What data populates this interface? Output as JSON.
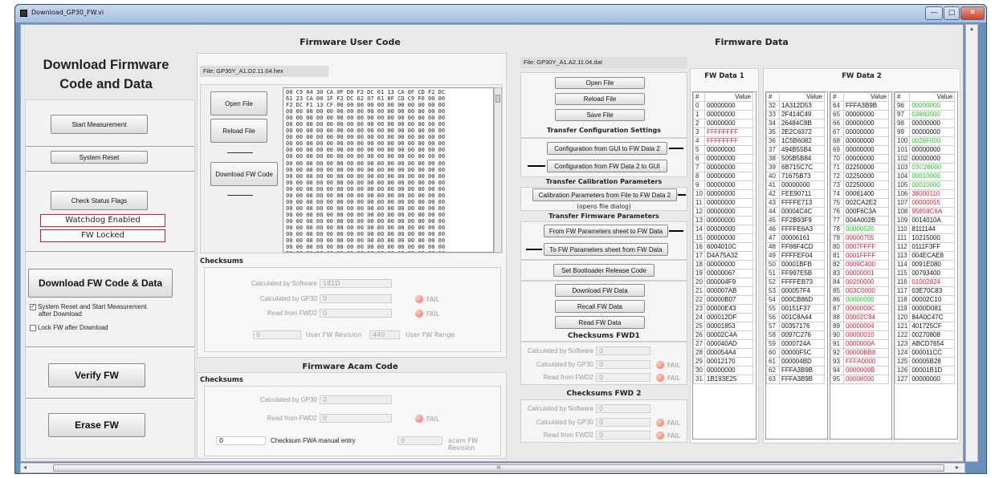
{
  "window": {
    "title": "Download_GP30_FW.vi"
  },
  "colors": {
    "red": "#e0203a",
    "green": "#22cc22",
    "black": "#111111"
  },
  "left": {
    "title_line1": "Download Firmware",
    "title_line2": "Code and Data",
    "start": "Start Measurement",
    "reset": "System Reset",
    "check": "Check Status Flags",
    "watchdog": "Watchdog Enabled",
    "fwlocked": "FW Locked",
    "download": "Download FW Code & Data",
    "opt1a": "System Reset and Start Measurement",
    "opt1b": "after Download",
    "opt2": "Lock FW after Download",
    "verify": "Verify FW",
    "erase": "Erase FW"
  },
  "usercode": {
    "title": "Firmware User Code",
    "file": "File:  GP30Y_A1.D2.11.04.hex",
    "open": "Open File",
    "reload": "Reload File",
    "download": "Download FW Code",
    "hex_lines": [
      "00 C9 04 30 CA 0F D0 F2 DC 61 13 CA 0F CD F2 DC",
      "61 23 CA 00 1F F2 DC 62 07 61 0F CD C9 F0 00 00",
      "F2 DC F1 13 CF 00 00 00 00 00 00 00 00 00 00 00",
      "00 00 00 00 00 00 00 00 00 00 00 00 00 00 00 00",
      "00 00 00 00 00 00 00 00 00 00 00 00 00 00 00 00",
      "00 00 00 00 00 00 00 00 00 00 00 00 00 00 00 00",
      "00 00 00 00 00 00 00 00 00 00 00 00 00 00 00 00",
      "00 00 00 00 00 00 00 00 00 00 00 00 00 00 00 00",
      "00 00 00 00 00 00 00 00 00 00 00 00 00 00 00 00",
      "00 00 00 00 00 00 00 00 00 00 00 00 00 00 00 00",
      "00 00 00 00 00 00 00 00 00 00 00 00 00 00 00 00",
      "00 00 00 00 00 00 00 00 00 00 00 00 00 00 00 00",
      "00 00 00 00 00 00 00 00 00 00 00 00 00 00 00 00",
      "00 00 00 00 00 00 00 00 00 00 00 00 00 00 00 00",
      "00 00 00 00 00 00 00 00 00 00 00 00 00 00 00 00",
      "00 00 00 00 00 00 00 00 00 00 00 00 00 00 00 00",
      "00 00 00 00 00 00 00 00 00 00 00 00 00 00 00 00",
      "00 00 00 00 00 00 00 00 00 00 00 00 00 00 00 00",
      "00 00 00 00 00 00 00 00 00 00 00 00 00 00 00 00",
      "00 00 00 00 00 00 00 00 00 00 00 00 00 00 00 00",
      "00 00 00 00 00 00 00 00 00 00 00 00 00 00 00 00",
      "00 00 00 00 00 00 00 00 00 00 00 00 00 00 00 00",
      "00 00 00 00 00 00 00 00 00 00 00 00 00 00 00 00",
      "00 00 00 00 00 00 00 00 00 00 00 00 00 00 00 00",
      "00 00 00 00 00 00 00 00 00 00 00 00 00 00 00 00",
      "00 00 00 00 00 00 00 00 00 00 00 00 00 00 00 00"
    ],
    "checksums": "Checksums",
    "calc_sw": "Calculated by Software",
    "calc_sw_val": "181D",
    "calc_gp30": "Calculated by GP30",
    "calc_gp30_val": "0",
    "read_fwd2": "Read from FWD2",
    "read_fwd2_val": "0",
    "fail": "FAIL",
    "rev_val": "0",
    "rev_label": "User FW Revision",
    "range_val": "440",
    "range_label": "User FW Range"
  },
  "acam": {
    "title": "Firmware Acam Code",
    "checksums": "Checksums",
    "calc_gp30": "Calculated by GP30",
    "calc_gp30_val": "0",
    "read_fwd2": "Read from FWD2",
    "read_fwd2_val": "0",
    "fail": "FAIL",
    "manual_val": "0",
    "manual_label": "Checksum FWA manual entry",
    "rev_val": "0",
    "rev_label": "acam FW Revision"
  },
  "fwdata": {
    "title": "Firmware Data",
    "file": "File:  GP30Y_A1.A2.11.04.dat",
    "open": "Open File",
    "reload": "Reload File",
    "save": "Save File",
    "tcs": "Transfer Configuration Settings",
    "gui_to_fw": "Configuration from GUI to FW Data 2",
    "fw_to_gui": "Configuration from FW Data 2 to GUI",
    "tcp": "Transfer Calibration Parameters",
    "cal": "Calibration Parameters from File to FW Data 2",
    "cal_note": "(opens file dialog)",
    "tfp": "Transfer Firmware Parameters",
    "from_sheet": "From FW Parameters sheet to FW Data",
    "to_sheet": "To FW Parameters sheet from FW Data",
    "bootloader": "Set Bootloader Release Code",
    "download": "Download FW Data",
    "recall": "Recall FW Data",
    "read": "Read FW Data",
    "cs1": "Checksums FWD1",
    "cs2": "Checksums FWD 2",
    "calc_sw": "Calculated by Software",
    "calc_gp30": "Calculated by GP30",
    "read_fwd2": "Read from FWD2",
    "zero": "0",
    "fail": "FAIL",
    "fwd1_title": "FW Data 1",
    "fwd2_title": "FW Data 2",
    "col_hash": "#",
    "col_value": "Value",
    "fwd1": [
      [
        "0",
        "00000000",
        "k"
      ],
      [
        "1",
        "00000000",
        "k"
      ],
      [
        "2",
        "00000000",
        "k"
      ],
      [
        "3",
        "FFFFFFFF",
        "r"
      ],
      [
        "4",
        "FFFFFFFF",
        "r"
      ],
      [
        "5",
        "00000000",
        "k"
      ],
      [
        "6",
        "00000000",
        "k"
      ],
      [
        "7",
        "00000000",
        "k"
      ],
      [
        "8",
        "00000000",
        "k"
      ],
      [
        "9",
        "00000000",
        "k"
      ],
      [
        "10",
        "00000000",
        "k"
      ],
      [
        "11",
        "00000000",
        "k"
      ],
      [
        "12",
        "00000000",
        "k"
      ],
      [
        "13",
        "00000000",
        "k"
      ],
      [
        "14",
        "00000000",
        "k"
      ],
      [
        "15",
        "00000000",
        "k"
      ],
      [
        "16",
        "6004010C",
        "k"
      ],
      [
        "17",
        "D4A75A32",
        "k"
      ],
      [
        "18",
        "00000000",
        "k"
      ],
      [
        "19",
        "00000067",
        "k"
      ],
      [
        "20",
        "000004F9",
        "k"
      ],
      [
        "21",
        "000007AB",
        "k"
      ],
      [
        "22",
        "00000B07",
        "k"
      ],
      [
        "23",
        "00000E43",
        "k"
      ],
      [
        "24",
        "000012DF",
        "k"
      ],
      [
        "25",
        "00001853",
        "k"
      ],
      [
        "26",
        "00002C4A",
        "k"
      ],
      [
        "27",
        "000040AD",
        "k"
      ],
      [
        "28",
        "000054A4",
        "k"
      ],
      [
        "29",
        "00012170",
        "k"
      ],
      [
        "30",
        "00000000",
        "k"
      ],
      [
        "31",
        "1B193E25",
        "k"
      ]
    ],
    "fwd2a": [
      [
        "32",
        "1A312D53",
        "k"
      ],
      [
        "33",
        "2F414C49",
        "k"
      ],
      [
        "34",
        "26484C8B",
        "k"
      ],
      [
        "35",
        "2E2C6372",
        "k"
      ],
      [
        "36",
        "1C5B6082",
        "k"
      ],
      [
        "37",
        "494B55B4",
        "k"
      ],
      [
        "38",
        "505B5B84",
        "k"
      ],
      [
        "39",
        "6B715C7C",
        "k"
      ],
      [
        "40",
        "71675B73",
        "k"
      ],
      [
        "41",
        "00000000",
        "k"
      ],
      [
        "42",
        "FEE90711",
        "k"
      ],
      [
        "43",
        "FFFFE713",
        "k"
      ],
      [
        "44",
        "00004C4C",
        "k"
      ],
      [
        "45",
        "FF2B93F9",
        "k"
      ],
      [
        "46",
        "FFFFE6A3",
        "k"
      ],
      [
        "47",
        "00006161",
        "k"
      ],
      [
        "48",
        "FF86F4CD",
        "k"
      ],
      [
        "49",
        "FFFFEF04",
        "k"
      ],
      [
        "50",
        "00001BFB",
        "k"
      ],
      [
        "51",
        "FF997E5B",
        "k"
      ],
      [
        "52",
        "FFFFEB73",
        "k"
      ],
      [
        "53",
        "000057F4",
        "k"
      ],
      [
        "54",
        "000CB86D",
        "k"
      ],
      [
        "55",
        "00151F37",
        "k"
      ],
      [
        "56",
        "001C8A44",
        "k"
      ],
      [
        "57",
        "00357176",
        "k"
      ],
      [
        "58",
        "0097C276",
        "k"
      ],
      [
        "59",
        "0000724A",
        "k"
      ],
      [
        "60",
        "00000F5C",
        "k"
      ],
      [
        "61",
        "000004BD",
        "k"
      ],
      [
        "62",
        "FFFA3B9B",
        "k"
      ],
      [
        "63",
        "FFFA3B9B",
        "k"
      ]
    ],
    "fwd2b": [
      [
        "64",
        "FFFA3B9B",
        "k"
      ],
      [
        "65",
        "00000000",
        "k"
      ],
      [
        "66",
        "00000000",
        "k"
      ],
      [
        "67",
        "00000000",
        "k"
      ],
      [
        "68",
        "00000000",
        "k"
      ],
      [
        "69",
        "00000000",
        "k"
      ],
      [
        "70",
        "00000000",
        "k"
      ],
      [
        "71",
        "02250000",
        "k"
      ],
      [
        "72",
        "02250000",
        "k"
      ],
      [
        "73",
        "02250000",
        "k"
      ],
      [
        "74",
        "00061400",
        "k"
      ],
      [
        "75",
        "002CA2E2",
        "k"
      ],
      [
        "76",
        "000F6C3A",
        "k"
      ],
      [
        "77",
        "004A002B",
        "k"
      ],
      [
        "78",
        "00000020",
        "g"
      ],
      [
        "79",
        "00000755",
        "r"
      ],
      [
        "80",
        "0007FFFF",
        "r"
      ],
      [
        "81",
        "0001FFFF",
        "r"
      ],
      [
        "82",
        "0009C400",
        "r"
      ],
      [
        "83",
        "00000001",
        "r"
      ],
      [
        "84",
        "00200000",
        "r"
      ],
      [
        "85",
        "003C0000",
        "r"
      ],
      [
        "86",
        "00000000",
        "g"
      ],
      [
        "87",
        "0000000C",
        "r"
      ],
      [
        "88",
        "00002C94",
        "r"
      ],
      [
        "89",
        "00000004",
        "r"
      ],
      [
        "90",
        "00000010",
        "r"
      ],
      [
        "91",
        "0000000A",
        "r"
      ],
      [
        "92",
        "00000BB8",
        "r"
      ],
      [
        "93",
        "FFFA0000",
        "r"
      ],
      [
        "94",
        "0000000B",
        "r"
      ],
      [
        "95",
        "00008000",
        "r"
      ]
    ],
    "fwd2c": [
      [
        "96",
        "00000000",
        "g"
      ],
      [
        "97",
        "03880000",
        "g"
      ],
      [
        "98",
        "00000000",
        "k"
      ],
      [
        "99",
        "00000000",
        "k"
      ],
      [
        "100",
        "0028F000",
        "g"
      ],
      [
        "101",
        "00000000",
        "k"
      ],
      [
        "102",
        "00000000",
        "k"
      ],
      [
        "103",
        "03C28000",
        "g"
      ],
      [
        "104",
        "00010000",
        "g"
      ],
      [
        "105",
        "00010000",
        "g"
      ],
      [
        "106",
        "38000110",
        "r"
      ],
      [
        "107",
        "00000055",
        "r"
      ],
      [
        "108",
        "95659C6A",
        "r"
      ],
      [
        "109",
        "0014010A",
        "k"
      ],
      [
        "110",
        "8111144",
        "k"
      ],
      [
        "111",
        "10215000",
        "k"
      ],
      [
        "112",
        "0111F3FF",
        "k"
      ],
      [
        "113",
        "004ECAE8",
        "k"
      ],
      [
        "114",
        "0091E080",
        "k"
      ],
      [
        "115",
        "00793400",
        "k"
      ],
      [
        "116",
        "01002824",
        "r"
      ],
      [
        "117",
        "03E70C83",
        "k"
      ],
      [
        "118",
        "00002C10",
        "k"
      ],
      [
        "119",
        "0000D081",
        "k"
      ],
      [
        "120",
        "84A0C47C",
        "k"
      ],
      [
        "121",
        "401725CF",
        "k"
      ],
      [
        "122",
        "00270808",
        "k"
      ],
      [
        "123",
        "ABCD7654",
        "k"
      ],
      [
        "124",
        "000011CC",
        "k"
      ],
      [
        "125",
        "00005B28",
        "k"
      ],
      [
        "126",
        "00001B1D",
        "k"
      ],
      [
        "127",
        "00000000",
        "k"
      ]
    ]
  },
  "scroll": {
    "h_grip": "III",
    "left": "◂",
    "right": "▸",
    "up": "▴"
  }
}
